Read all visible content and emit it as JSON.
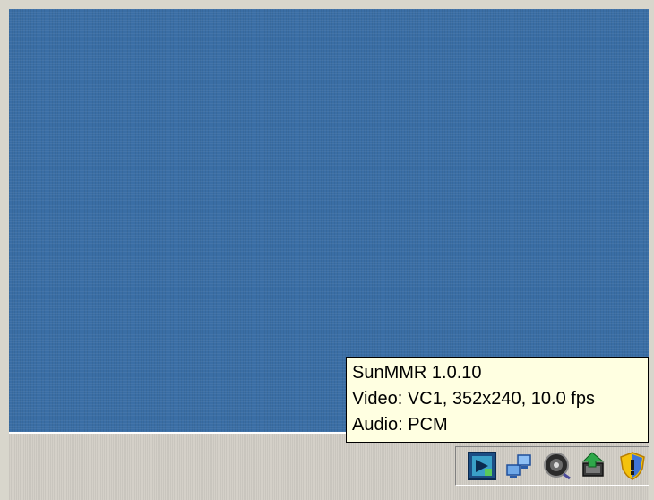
{
  "tooltip": {
    "line1": "SunMMR 1.0.10",
    "line2": "Video: VC1, 352x240, 10.0 fps",
    "line3": "Audio: PCM"
  },
  "tray": {
    "icons": [
      "media-app-icon",
      "network-connection-icon",
      "volume-icon",
      "update-icon",
      "security-shield-icon"
    ]
  },
  "colors": {
    "desktop": "#3a6ea5",
    "taskbar": "#d4d0c8",
    "tooltip_bg": "#ffffe1"
  }
}
